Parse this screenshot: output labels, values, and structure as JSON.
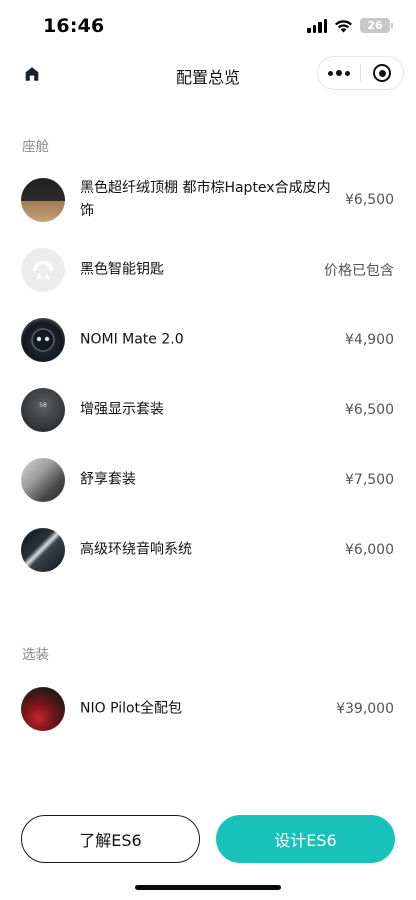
{
  "status_bar": {
    "time": "16:46",
    "battery_level": "26",
    "icons": [
      "cellular-signal-icon",
      "wifi-icon",
      "battery-icon"
    ]
  },
  "header": {
    "title": "配置总览",
    "icons": [
      "home-icon",
      "more-dots-icon",
      "close-target-icon"
    ]
  },
  "sections": {
    "cabin": {
      "title": "座舱",
      "items": [
        {
          "name": "黑色超纤绒顶棚 都市棕Haptex合成皮内饰",
          "price": "¥6,500"
        },
        {
          "name": "黑色智能钥匙",
          "price": "价格已包含"
        },
        {
          "name": "NOMI Mate 2.0",
          "price": "¥4,900"
        },
        {
          "name": "增强显示套装",
          "price": "¥6,500"
        },
        {
          "name": "舒享套装",
          "price": "¥7,500"
        },
        {
          "name": "高级环绕音响系统",
          "price": "¥6,000"
        }
      ]
    },
    "options": {
      "title": "选装",
      "items": [
        {
          "name": "NIO Pilot全配包",
          "price": "¥39,000"
        }
      ]
    }
  },
  "thumbnail_hud_text": "58",
  "footer": {
    "learn_label": "了解ES6",
    "design_label": "设计ES6"
  },
  "colors": {
    "accent": "#18c2bb",
    "section_title": "#8a8a8a",
    "price_text": "#555555"
  }
}
